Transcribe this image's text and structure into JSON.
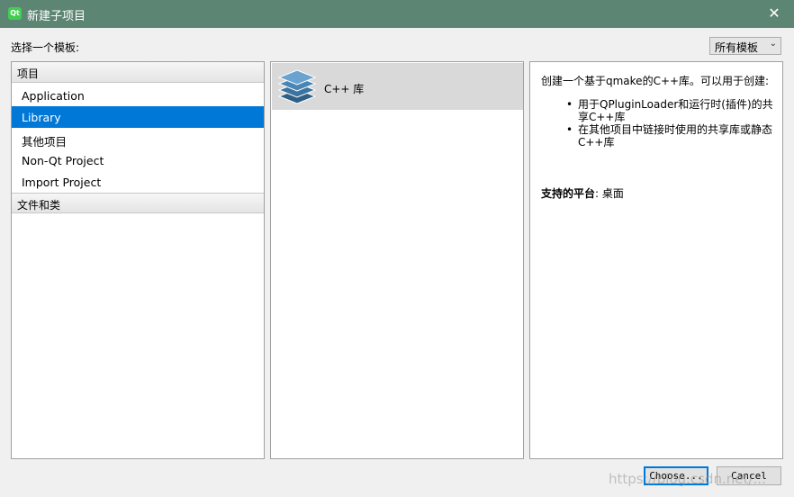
{
  "window": {
    "title": "新建子项目",
    "close_glyph": "✕"
  },
  "app_icon": "qt-logo-icon",
  "choose_template_label": "选择一个模板:",
  "filter": {
    "selected": "所有模板"
  },
  "categories": [
    {
      "label": "项目",
      "type": "header"
    },
    {
      "label": "Application",
      "type": "item"
    },
    {
      "label": "Library",
      "type": "item",
      "selected": true
    },
    {
      "label": "其他项目",
      "type": "item"
    },
    {
      "label": "Non-Qt Project",
      "type": "item"
    },
    {
      "label": "Import Project",
      "type": "item"
    },
    {
      "label": "文件和类",
      "type": "header"
    }
  ],
  "templates": [
    {
      "label": "C++ 库",
      "icon": "layered-stack-icon",
      "selected": true
    }
  ],
  "description": {
    "intro": "创建一个基于qmake的C++库。可以用于创建:",
    "bullets": [
      "用于QPluginLoader和运行时(插件)的共享C++库",
      "在其他项目中链接时使用的共享库或静态C++库"
    ],
    "platforms_label": "支持的平台",
    "platforms_value": ": 桌面"
  },
  "buttons": {
    "choose": "Choose...",
    "cancel": "Cancel"
  },
  "watermark": "https://blog.csdn.net/...",
  "colors": {
    "titlebar": "#5d8574",
    "selection": "#0078d7",
    "template_selected": "#d9d9d9"
  }
}
